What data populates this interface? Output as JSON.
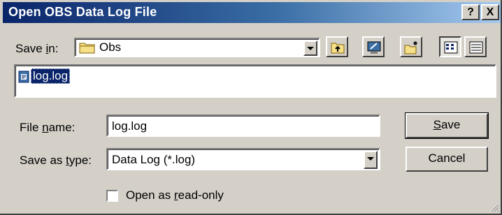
{
  "window": {
    "title": "Open OBS Data Log File",
    "help_button": "?",
    "close_button": "X"
  },
  "save_in": {
    "label_pre": "Save ",
    "label_accel": "i",
    "label_post": "n:",
    "value": "Obs",
    "folder_icon": "folder-icon"
  },
  "toolbar": {
    "buttons": [
      "up-one-level-icon",
      "desktop-icon",
      "new-folder-icon",
      "list-view-icon",
      "details-view-icon"
    ]
  },
  "file_list": {
    "items": [
      {
        "name": "log.log",
        "icon": "log-file-icon",
        "selected": true
      }
    ]
  },
  "file_name": {
    "label_pre": "File ",
    "label_accel": "n",
    "label_post": "ame:",
    "value": "log.log"
  },
  "save_as_type": {
    "label_pre": "Save as ",
    "label_accel": "t",
    "label_post": "ype:",
    "value": "Data Log (*.log)"
  },
  "buttons": {
    "save_accel": "S",
    "save_rest": "ave",
    "cancel": "Cancel"
  },
  "read_only": {
    "label_pre": "Open as ",
    "label_accel": "r",
    "label_post": "ead-only",
    "checked": false
  },
  "colors": {
    "title_start": "#0a246a",
    "title_end": "#a6caf0",
    "selection": "#0a246a",
    "face": "#d4d0c8"
  }
}
